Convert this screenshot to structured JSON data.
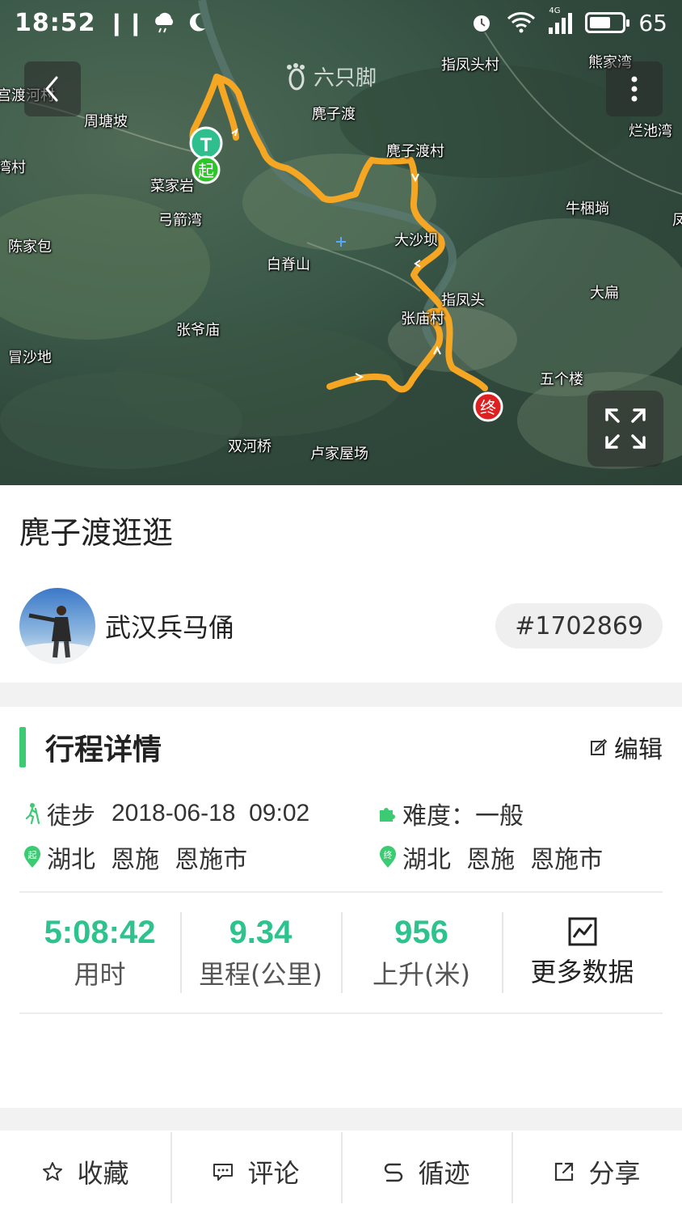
{
  "status_bar": {
    "time": "18:52",
    "battery": "65",
    "battery_level_percent": 65,
    "network": "4G"
  },
  "map": {
    "watermark": "六只脚",
    "start_marker": "起",
    "end_marker": "终",
    "t_marker": "T",
    "labels": [
      "宫渡河村",
      "周塘坡",
      "湾村",
      "菜家岩",
      "弓箭湾",
      "陈家包",
      "白脊山",
      "张爷庙",
      "冒沙地",
      "双河桥",
      "卢家屋场",
      "麂子渡",
      "麂子渡村",
      "指凤头村",
      "熊家湾",
      "烂池湾",
      "牛梱埫",
      "大沙坝",
      "指凤头",
      "张庙村",
      "大扁",
      "五个楼",
      "凤"
    ]
  },
  "trip": {
    "title": "麂子渡逛逛",
    "author": "武汉兵马俑",
    "id": "#1702869"
  },
  "details": {
    "section_title": "行程详情",
    "edit_label": "编辑",
    "activity_type": "徒步",
    "datetime": "2018-06-18  09:02",
    "difficulty": "难度：一般",
    "start_location": "湖北  恩施  恩施市",
    "end_location": "湖北  恩施  恩施市"
  },
  "stats": [
    {
      "value": "5:08:42",
      "label": "用时"
    },
    {
      "value": "9.34",
      "label": "里程(公里)"
    },
    {
      "value": "956",
      "label": "上升(米)"
    }
  ],
  "more_data_label": "更多数据",
  "bottom_bar": {
    "favorite": "收藏",
    "comment": "评论",
    "follow_track": "循迹",
    "share": "分享"
  },
  "colors": {
    "accent_green": "#3ccb72",
    "stat_green": "#2ec28e",
    "track_orange": "#f5a623",
    "end_red": "#e02020"
  }
}
